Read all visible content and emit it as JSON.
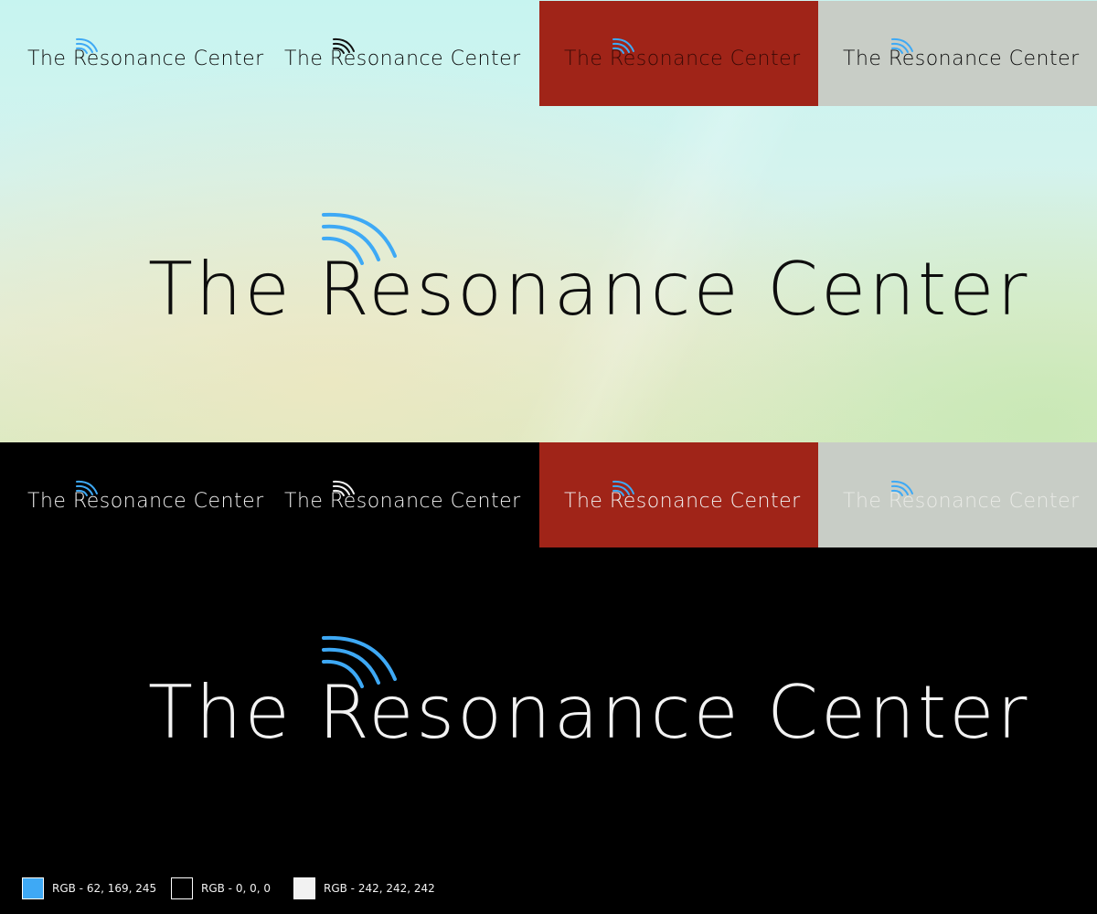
{
  "brand": {
    "name": "The Resonance Center",
    "accent_color": "#3ea9f5",
    "dark_color": "#000000",
    "light_color": "#f2f2f2",
    "red_panel_color": "#a02418",
    "gray_panel_color": "#c8cdc6"
  },
  "light_section": {
    "variant_logos": [
      {
        "text": "The Resonance Center",
        "background": "none"
      },
      {
        "text": "The Resonance Center",
        "background": "none"
      },
      {
        "text": "The Resonance Center",
        "background": "red"
      },
      {
        "text": "The Resonance Center",
        "background": "gray"
      }
    ],
    "main_logo": {
      "text": "The Resonance Center"
    }
  },
  "dark_section": {
    "variant_logos": [
      {
        "text": "The Resonance Center",
        "background": "none"
      },
      {
        "text": "The Resonance Center",
        "background": "none"
      },
      {
        "text": "The Resonance Center",
        "background": "red"
      },
      {
        "text": "The Resonance Center",
        "background": "gray"
      }
    ],
    "main_logo": {
      "text": "The Resonance Center"
    }
  },
  "palette": [
    {
      "label": "RGB - 62, 169, 245",
      "color": "#3ea9f5"
    },
    {
      "label": "RGB - 0, 0, 0",
      "color": "#000000"
    },
    {
      "label": "RGB - 242, 242, 242",
      "color": "#f2f2f2"
    }
  ]
}
